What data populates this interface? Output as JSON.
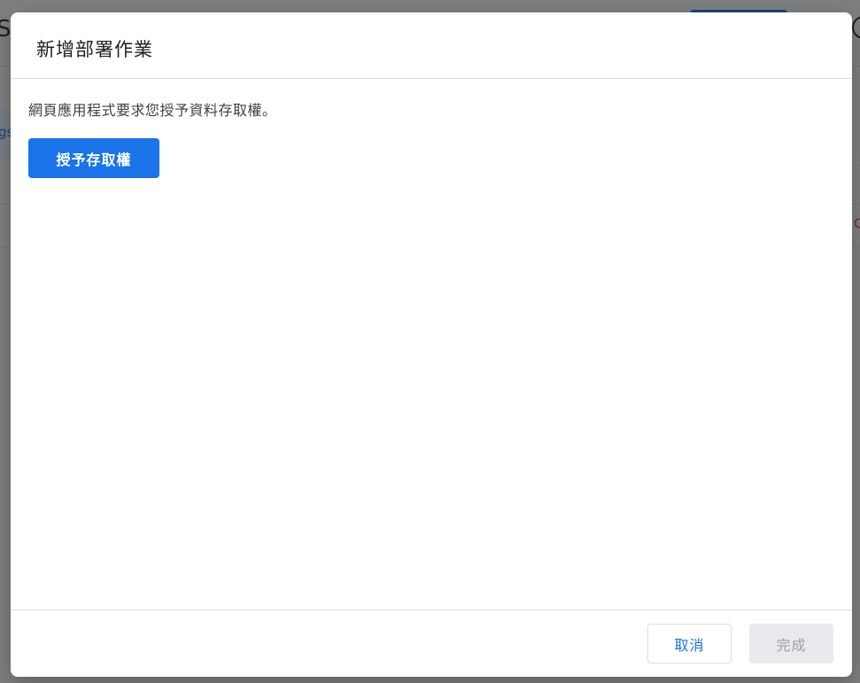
{
  "background": {
    "title_fragment": "So",
    "left_tab_fragment": "gs",
    "right_text_fragment": "C"
  },
  "dialog": {
    "title": "新增部署作業",
    "message": "網頁應用程式要求您授予資料存取權。",
    "grant_button_label": "授予存取權",
    "cancel_label": "取消",
    "done_label": "完成"
  },
  "colors": {
    "accent": "#1a73e8",
    "disabled_bg": "#e8eaed",
    "disabled_text": "#9aa0a6",
    "divider": "#dadce0"
  }
}
